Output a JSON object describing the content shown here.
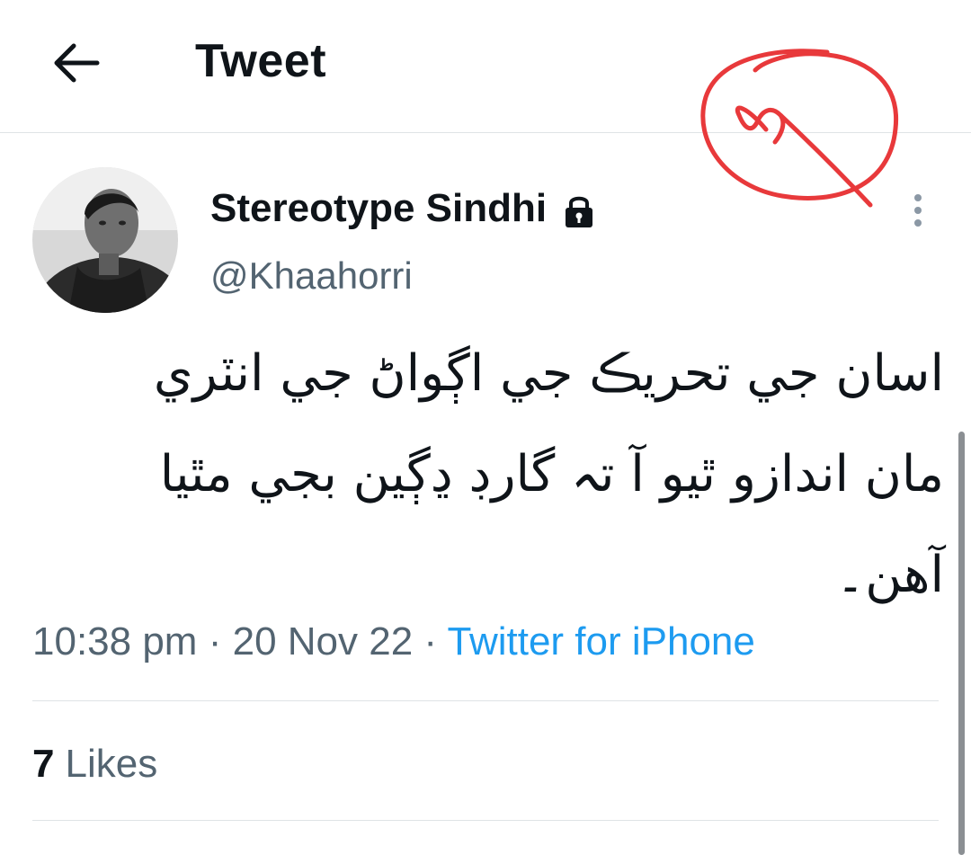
{
  "header": {
    "title": "Tweet",
    "back_icon": "arrow-left-icon"
  },
  "author": {
    "display_name": "Stereotype Sindhi",
    "handle": "@Khaahorri",
    "protected_icon": "lock-icon"
  },
  "tweet": {
    "text": "اسان جي تحريڪ جي اڳواڻ جي انٽري مان اندازو ٿيو آ تہ گارڊ ڍڳين بجي مٿيا آهن۔",
    "time": "10:38 pm",
    "separator": "·",
    "date": "20 Nov 22",
    "source": "Twitter for iPhone"
  },
  "stats": {
    "likes_count": "7",
    "likes_label": "Likes"
  },
  "colors": {
    "text": "#0f1419",
    "secondary": "#536471",
    "link": "#1d9bf0",
    "annotation": "#e8393b"
  }
}
